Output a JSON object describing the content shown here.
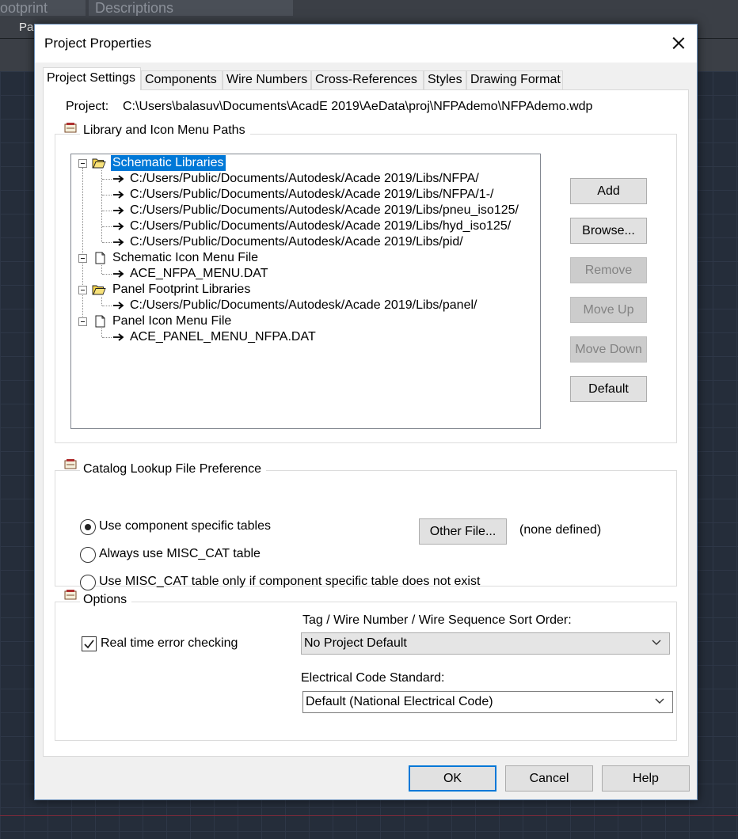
{
  "background": {
    "tab1": "ootprint",
    "tab2": "Descriptions",
    "pa": "Pa"
  },
  "dialog": {
    "title": "Project Properties"
  },
  "tabs": [
    {
      "label": "Project Settings",
      "active": true
    },
    {
      "label": "Components"
    },
    {
      "label": "Wire Numbers"
    },
    {
      "label": "Cross-References"
    },
    {
      "label": "Styles"
    },
    {
      "label": "Drawing Format"
    }
  ],
  "project": {
    "label": "Project:",
    "path": "C:\\Users\\balasuv\\Documents\\AcadE 2019\\AeData\\proj\\NFPAdemo\\NFPAdemo.wdp"
  },
  "library_group": {
    "title": "Library and Icon Menu Paths",
    "tree": [
      {
        "label": "Schematic Libraries",
        "icon": "open-folder-icon",
        "selected": true,
        "children": [
          "C:/Users/Public/Documents/Autodesk/Acade 2019/Libs/NFPA/",
          "C:/Users/Public/Documents/Autodesk/Acade 2019/Libs/NFPA/1-/",
          "C:/Users/Public/Documents/Autodesk/Acade 2019/Libs/pneu_iso125/",
          "C:/Users/Public/Documents/Autodesk/Acade 2019/Libs/hyd_iso125/",
          "C:/Users/Public/Documents/Autodesk/Acade 2019/Libs/pid/"
        ]
      },
      {
        "label": "Schematic Icon Menu File",
        "icon": "document-icon",
        "children": [
          "ACE_NFPA_MENU.DAT"
        ]
      },
      {
        "label": "Panel Footprint Libraries",
        "icon": "open-folder-icon",
        "children": [
          "C:/Users/Public/Documents/Autodesk/Acade 2019/Libs/panel/"
        ]
      },
      {
        "label": "Panel Icon Menu File",
        "icon": "document-icon",
        "children": [
          "ACE_PANEL_MENU_NFPA.DAT"
        ]
      }
    ],
    "buttons": {
      "add": "Add",
      "browse": "Browse...",
      "remove": "Remove",
      "move_up": "Move Up",
      "move_down": "Move Down",
      "default": "Default"
    }
  },
  "catalog_group": {
    "title": "Catalog Lookup File Preference",
    "options": [
      {
        "label": "Use component specific tables",
        "checked": true
      },
      {
        "label": "Always use MISC_CAT table",
        "checked": false
      },
      {
        "label": "Use MISC_CAT table only if component specific table does not exist",
        "checked": false
      }
    ],
    "other_file_button": "Other File...",
    "other_file_status": "(none defined)"
  },
  "options_group": {
    "title": "Options",
    "realtime_check": {
      "label": "Real time error checking",
      "checked": true
    },
    "sort_order": {
      "label": "Tag / Wire Number / Wire Sequence Sort Order:",
      "value": "No Project Default"
    },
    "code_standard": {
      "label": "Electrical Code Standard:",
      "value": "Default (National Electrical Code)"
    }
  },
  "footer": {
    "ok": "OK",
    "cancel": "Cancel",
    "help": "Help"
  },
  "colors": {
    "selection": "#0078d7",
    "dialog_bg": "#f0f0f0",
    "panel_bg": "#ffffff"
  }
}
